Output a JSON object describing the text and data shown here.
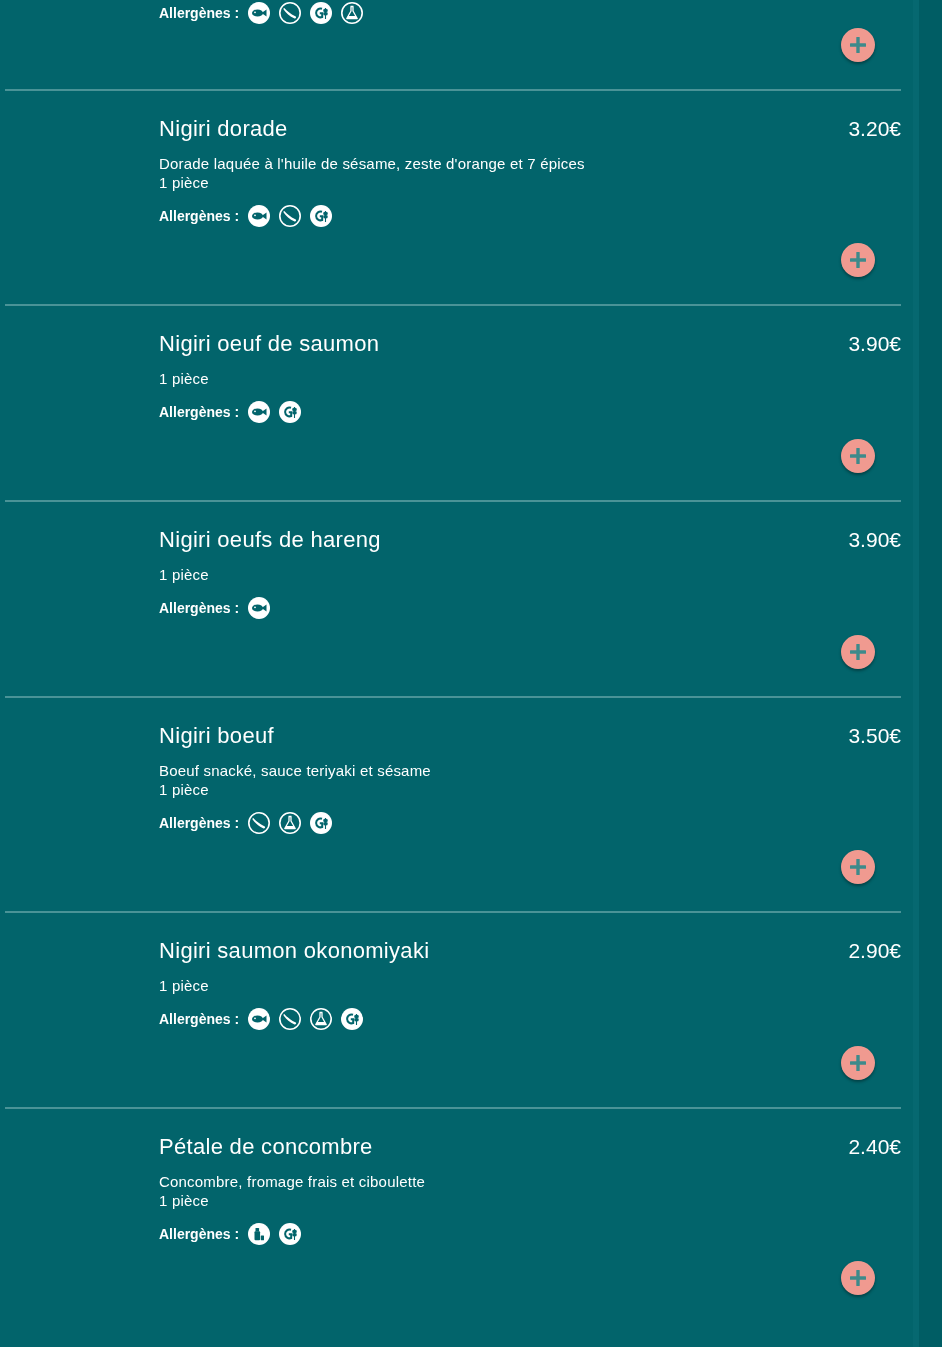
{
  "previous_item": {
    "allergens_label": "Allergènes :",
    "allergens": [
      {
        "kind": "fish"
      },
      {
        "kind": "pod"
      },
      {
        "kind": "wheat"
      },
      {
        "kind": "flask"
      }
    ]
  },
  "items": [
    {
      "name": "Nigiri dorade",
      "price": "3.20€",
      "description": "Dorade laquée à l'huile de sésame, zeste d'orange et 7 épices",
      "quantity": "1 pièce",
      "allergens_label": "Allergènes :",
      "allergens": [
        {
          "kind": "fish"
        },
        {
          "kind": "pod"
        },
        {
          "kind": "wheat"
        }
      ]
    },
    {
      "name": "Nigiri oeuf de saumon",
      "price": "3.90€",
      "quantity": "1 pièce",
      "allergens_label": "Allergènes :",
      "allergens": [
        {
          "kind": "fish"
        },
        {
          "kind": "wheat"
        }
      ]
    },
    {
      "name": "Nigiri oeufs de hareng",
      "price": "3.90€",
      "quantity": "1 pièce",
      "allergens_label": "Allergènes :",
      "allergens": [
        {
          "kind": "fish"
        }
      ]
    },
    {
      "name": "Nigiri boeuf",
      "price": "3.50€",
      "description": "Boeuf snacké, sauce teriyaki et sésame",
      "quantity": "1 pièce",
      "allergens_label": "Allergènes :",
      "allergens": [
        {
          "kind": "pod"
        },
        {
          "kind": "flask"
        },
        {
          "kind": "wheat"
        }
      ]
    },
    {
      "name": "Nigiri saumon okonomiyaki",
      "price": "2.90€",
      "quantity": "1 pièce",
      "allergens_label": "Allergènes :",
      "allergens": [
        {
          "kind": "fish"
        },
        {
          "kind": "pod"
        },
        {
          "kind": "flask"
        },
        {
          "kind": "wheat"
        }
      ]
    },
    {
      "name": "Pétale de concombre",
      "price": "2.40€",
      "description": "Concombre, fromage frais et ciboulette",
      "quantity": "1 pièce",
      "allergens_label": "Allergènes :",
      "allergens": [
        {
          "kind": "bottle"
        },
        {
          "kind": "wheat"
        }
      ]
    }
  ]
}
